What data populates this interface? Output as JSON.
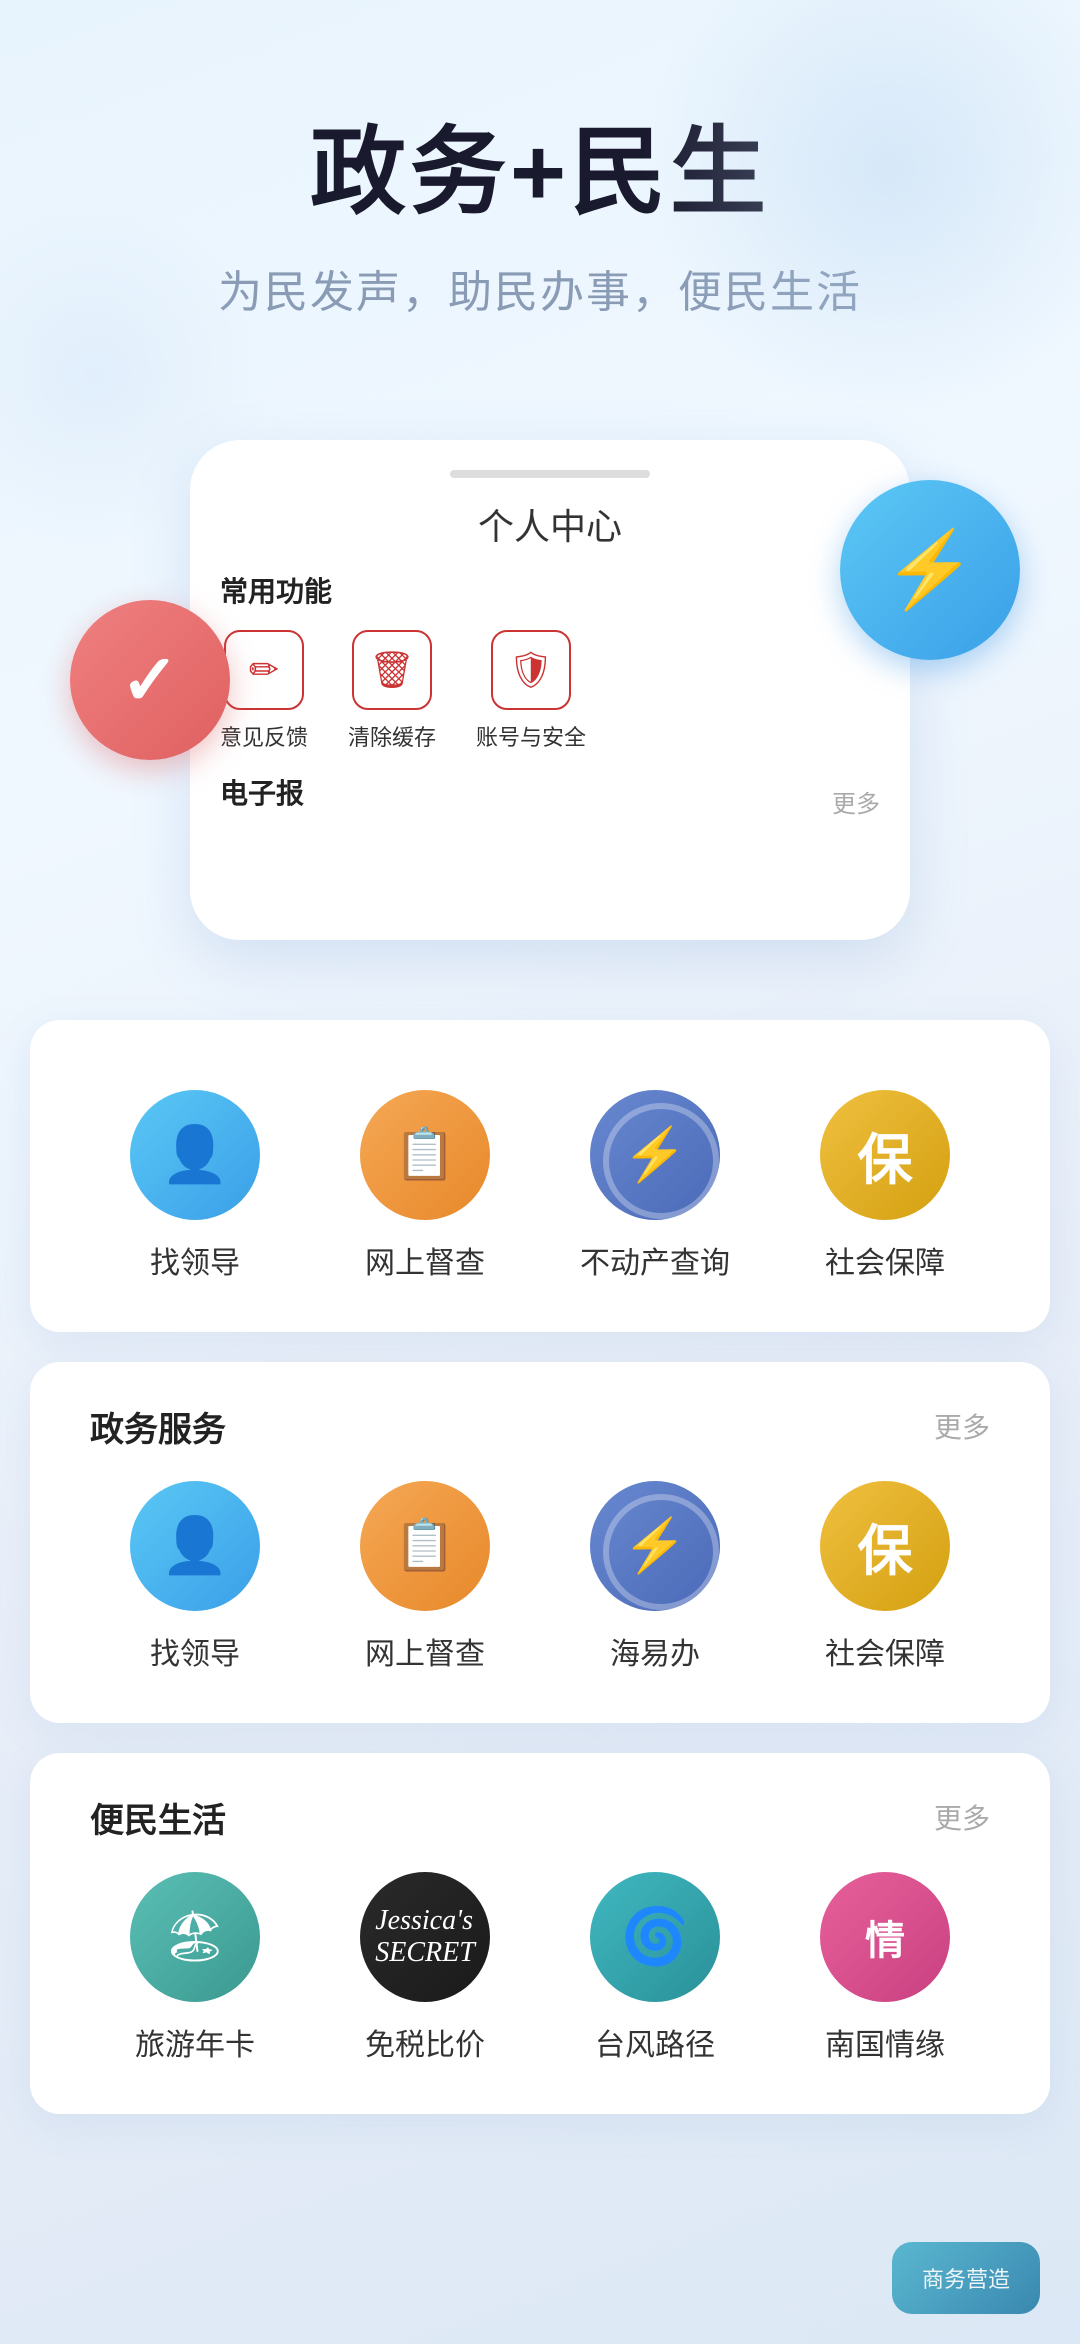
{
  "hero": {
    "title": "政务+民生",
    "subtitle": "为民发声，助民办事，便民生活"
  },
  "phone_mockup": {
    "title": "个人中心",
    "section_common": "常用功能",
    "section_newspaper": "电子报",
    "more_text": "更多",
    "icons": [
      {
        "label": "意见反馈",
        "symbol": "✏️",
        "type": "edit"
      },
      {
        "label": "清除缓存",
        "symbol": "🗑",
        "type": "trash"
      },
      {
        "label": "账号与安全",
        "symbol": "🛡",
        "type": "shield"
      }
    ]
  },
  "featured_services": {
    "items": [
      {
        "label": "找领导",
        "icon": "👤",
        "color": "blue"
      },
      {
        "label": "网上督查",
        "icon": "📋",
        "color": "orange"
      },
      {
        "label": "不动产查询",
        "icon": "⚡",
        "color": "pattern"
      },
      {
        "label": "社会保障",
        "icon": "保",
        "color": "gold"
      }
    ]
  },
  "gov_services": {
    "title": "政务服务",
    "more": "更多",
    "items": [
      {
        "label": "找领导",
        "icon": "👤",
        "color": "blue"
      },
      {
        "label": "网上督查",
        "icon": "📋",
        "color": "orange"
      },
      {
        "label": "海易办",
        "icon": "⚡",
        "color": "pattern"
      },
      {
        "label": "社会保障",
        "icon": "保",
        "color": "gold"
      }
    ]
  },
  "life_services": {
    "title": "便民生活",
    "more": "更多",
    "items": [
      {
        "label": "旅游年卡",
        "icon": "🏖",
        "color": "teal"
      },
      {
        "label": "免税比价",
        "icon": "JS",
        "color": "dark"
      },
      {
        "label": "台风路径",
        "icon": "🌀",
        "color": "teal2"
      },
      {
        "label": "南国情缘",
        "icon": "情",
        "color": "pink"
      }
    ]
  },
  "watermark": "商务营造"
}
